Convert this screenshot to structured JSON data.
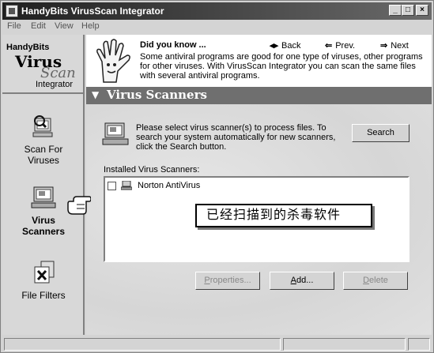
{
  "window": {
    "title": "HandyBits VirusScan Integrator"
  },
  "menu": [
    "File",
    "Edit",
    "View",
    "Help"
  ],
  "brand": {
    "line1": "HandyBits",
    "line2": "Virus",
    "line3": "Scan",
    "line4": "Integrator"
  },
  "sidebar": {
    "items": [
      {
        "line1": "Scan For",
        "line2": "Viruses",
        "icon": "magnifier-scan-icon"
      },
      {
        "line1": "Virus",
        "line2": "Scanners",
        "icon": "computer-icon"
      },
      {
        "line1": "File Filters",
        "line2": "",
        "icon": "file-filter-icon"
      }
    ]
  },
  "tip": {
    "title": "Did you know ...",
    "text": "Some antiviral programs are good for one type of viruses, other programs for other viruses. With VirusScan Integrator you can scan the same files with several antiviral programs.",
    "back": "Back",
    "prev": "Prev.",
    "next": "Next"
  },
  "section": {
    "title": "Virus Scanners"
  },
  "main": {
    "instruction": "Please select virus scanner(s) to process files. To search your system automatically for new scanners, click the Search button.",
    "search_button": "Search",
    "installed_label": "Installed Virus Scanners:",
    "scanners": [
      {
        "name": "Norton AntiVirus",
        "checked": false
      }
    ],
    "annotation": "已经扫描到的杀毒软件",
    "properties_first": "P",
    "properties_rest": "roperties...",
    "add_first": "A",
    "add_rest": "dd...",
    "delete_first": "D",
    "delete_rest": "elete"
  },
  "colors": {
    "section_header_bg": "#6f6f6f",
    "title_bar_start": "#202020",
    "tip_bg": "#ffffff"
  }
}
